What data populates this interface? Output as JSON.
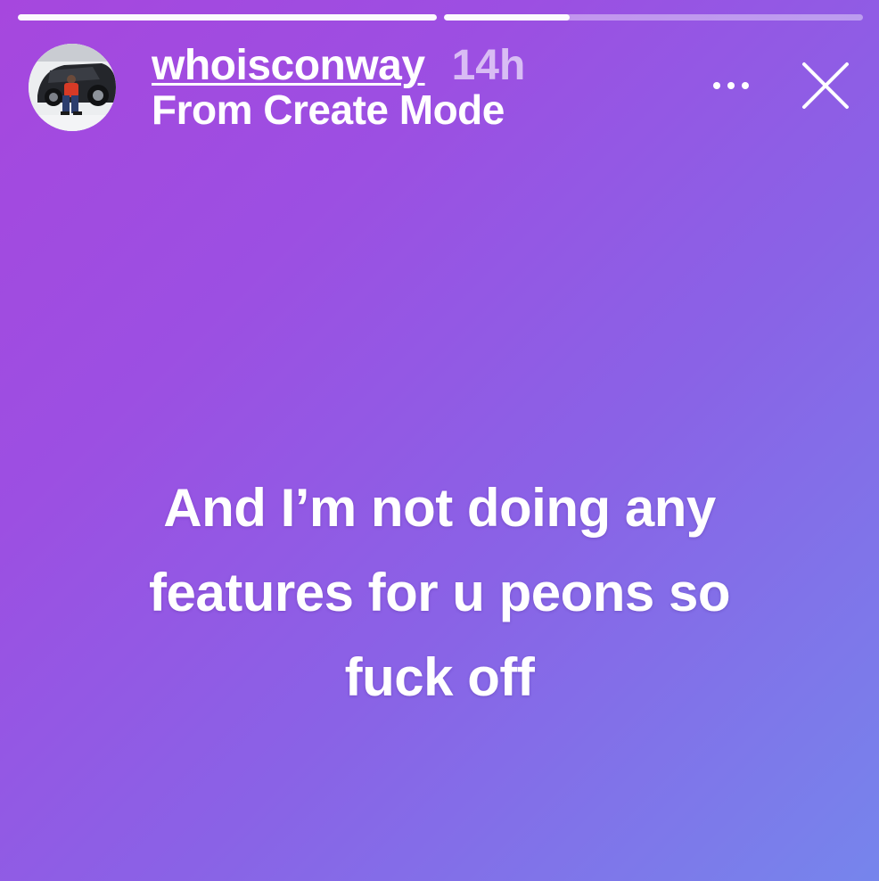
{
  "progress": [
    {
      "fill": 1.0
    },
    {
      "fill": 0.3
    }
  ],
  "header": {
    "username": "whoisconway",
    "timestamp": "14h",
    "subtitle": "From Create Mode"
  },
  "icons": {
    "more": "more-horizontal-icon",
    "close": "close-icon"
  },
  "story": {
    "caption_lines": [
      "And I’m not doing any",
      "features for u peons so",
      "fuck off"
    ]
  },
  "colors": {
    "gradient_start": "#a647de",
    "gradient_end": "#7685ec",
    "text": "#ffffff"
  }
}
